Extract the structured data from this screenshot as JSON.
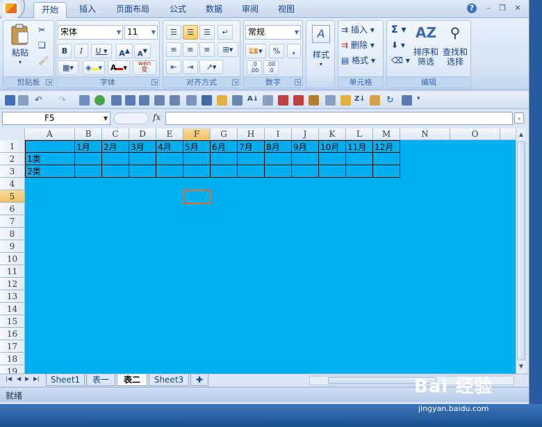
{
  "tabs": [
    {
      "label": "开始",
      "active": true
    },
    {
      "label": "插入",
      "active": false
    },
    {
      "label": "页面布局",
      "active": false
    },
    {
      "label": "公式",
      "active": false
    },
    {
      "label": "数据",
      "active": false
    },
    {
      "label": "审阅",
      "active": false
    },
    {
      "label": "视图",
      "active": false
    }
  ],
  "ribbon": {
    "clipboard": {
      "paste_label": "粘贴",
      "group_label": "剪贴板"
    },
    "font": {
      "font_name": "宋体",
      "font_size": "11",
      "group_label": "字体",
      "wen_label": "wén\n变"
    },
    "alignment": {
      "group_label": "对齐方式"
    },
    "number": {
      "format": "常规",
      "percent": "%",
      "comma": ",",
      "group_label": "数字",
      "dec_inc": ".0\n.00",
      "dec_dec": ".00\n.0"
    },
    "styles": {
      "label": "样式"
    },
    "cells": {
      "insert": "插入",
      "delete": "删除",
      "format": "格式",
      "group_label": "单元格"
    },
    "editing": {
      "sort_label": "排序和\n筛选",
      "find_label": "查找和\n选择",
      "group_label": "编辑"
    }
  },
  "formula_bar": {
    "name_box": "F5",
    "fx": "fx",
    "formula": ""
  },
  "columns": [
    "A",
    "B",
    "C",
    "D",
    "E",
    "F",
    "G",
    "H",
    "I",
    "J",
    "K",
    "L",
    "M",
    "N",
    "O"
  ],
  "rows": [
    "1",
    "2",
    "3",
    "4",
    "5",
    "6",
    "7",
    "8",
    "9",
    "10",
    "11",
    "12",
    "13",
    "14",
    "15",
    "16",
    "17",
    "18",
    "19"
  ],
  "table": {
    "header": [
      "",
      "1月",
      "2月",
      "3月",
      "4月",
      "5月",
      "6月",
      "7月",
      "8月",
      "9月",
      "10月",
      "11月",
      "12月"
    ],
    "row_labels": [
      "1类",
      "2类"
    ]
  },
  "selection": {
    "column": "F",
    "row": "5"
  },
  "sheet_tabs": [
    {
      "label": "Sheet1",
      "active": false
    },
    {
      "label": "表一",
      "active": false
    },
    {
      "label": "表二",
      "active": true
    },
    {
      "label": "Sheet3",
      "active": false
    }
  ],
  "status": "就绪",
  "watermark": {
    "brand": "Bai 经验",
    "url": "jingyan.baidu.com"
  },
  "colors": {
    "grid_fill": "#00b0f0",
    "selection_border": "#e8682c",
    "ribbon_text": "#15428b"
  }
}
